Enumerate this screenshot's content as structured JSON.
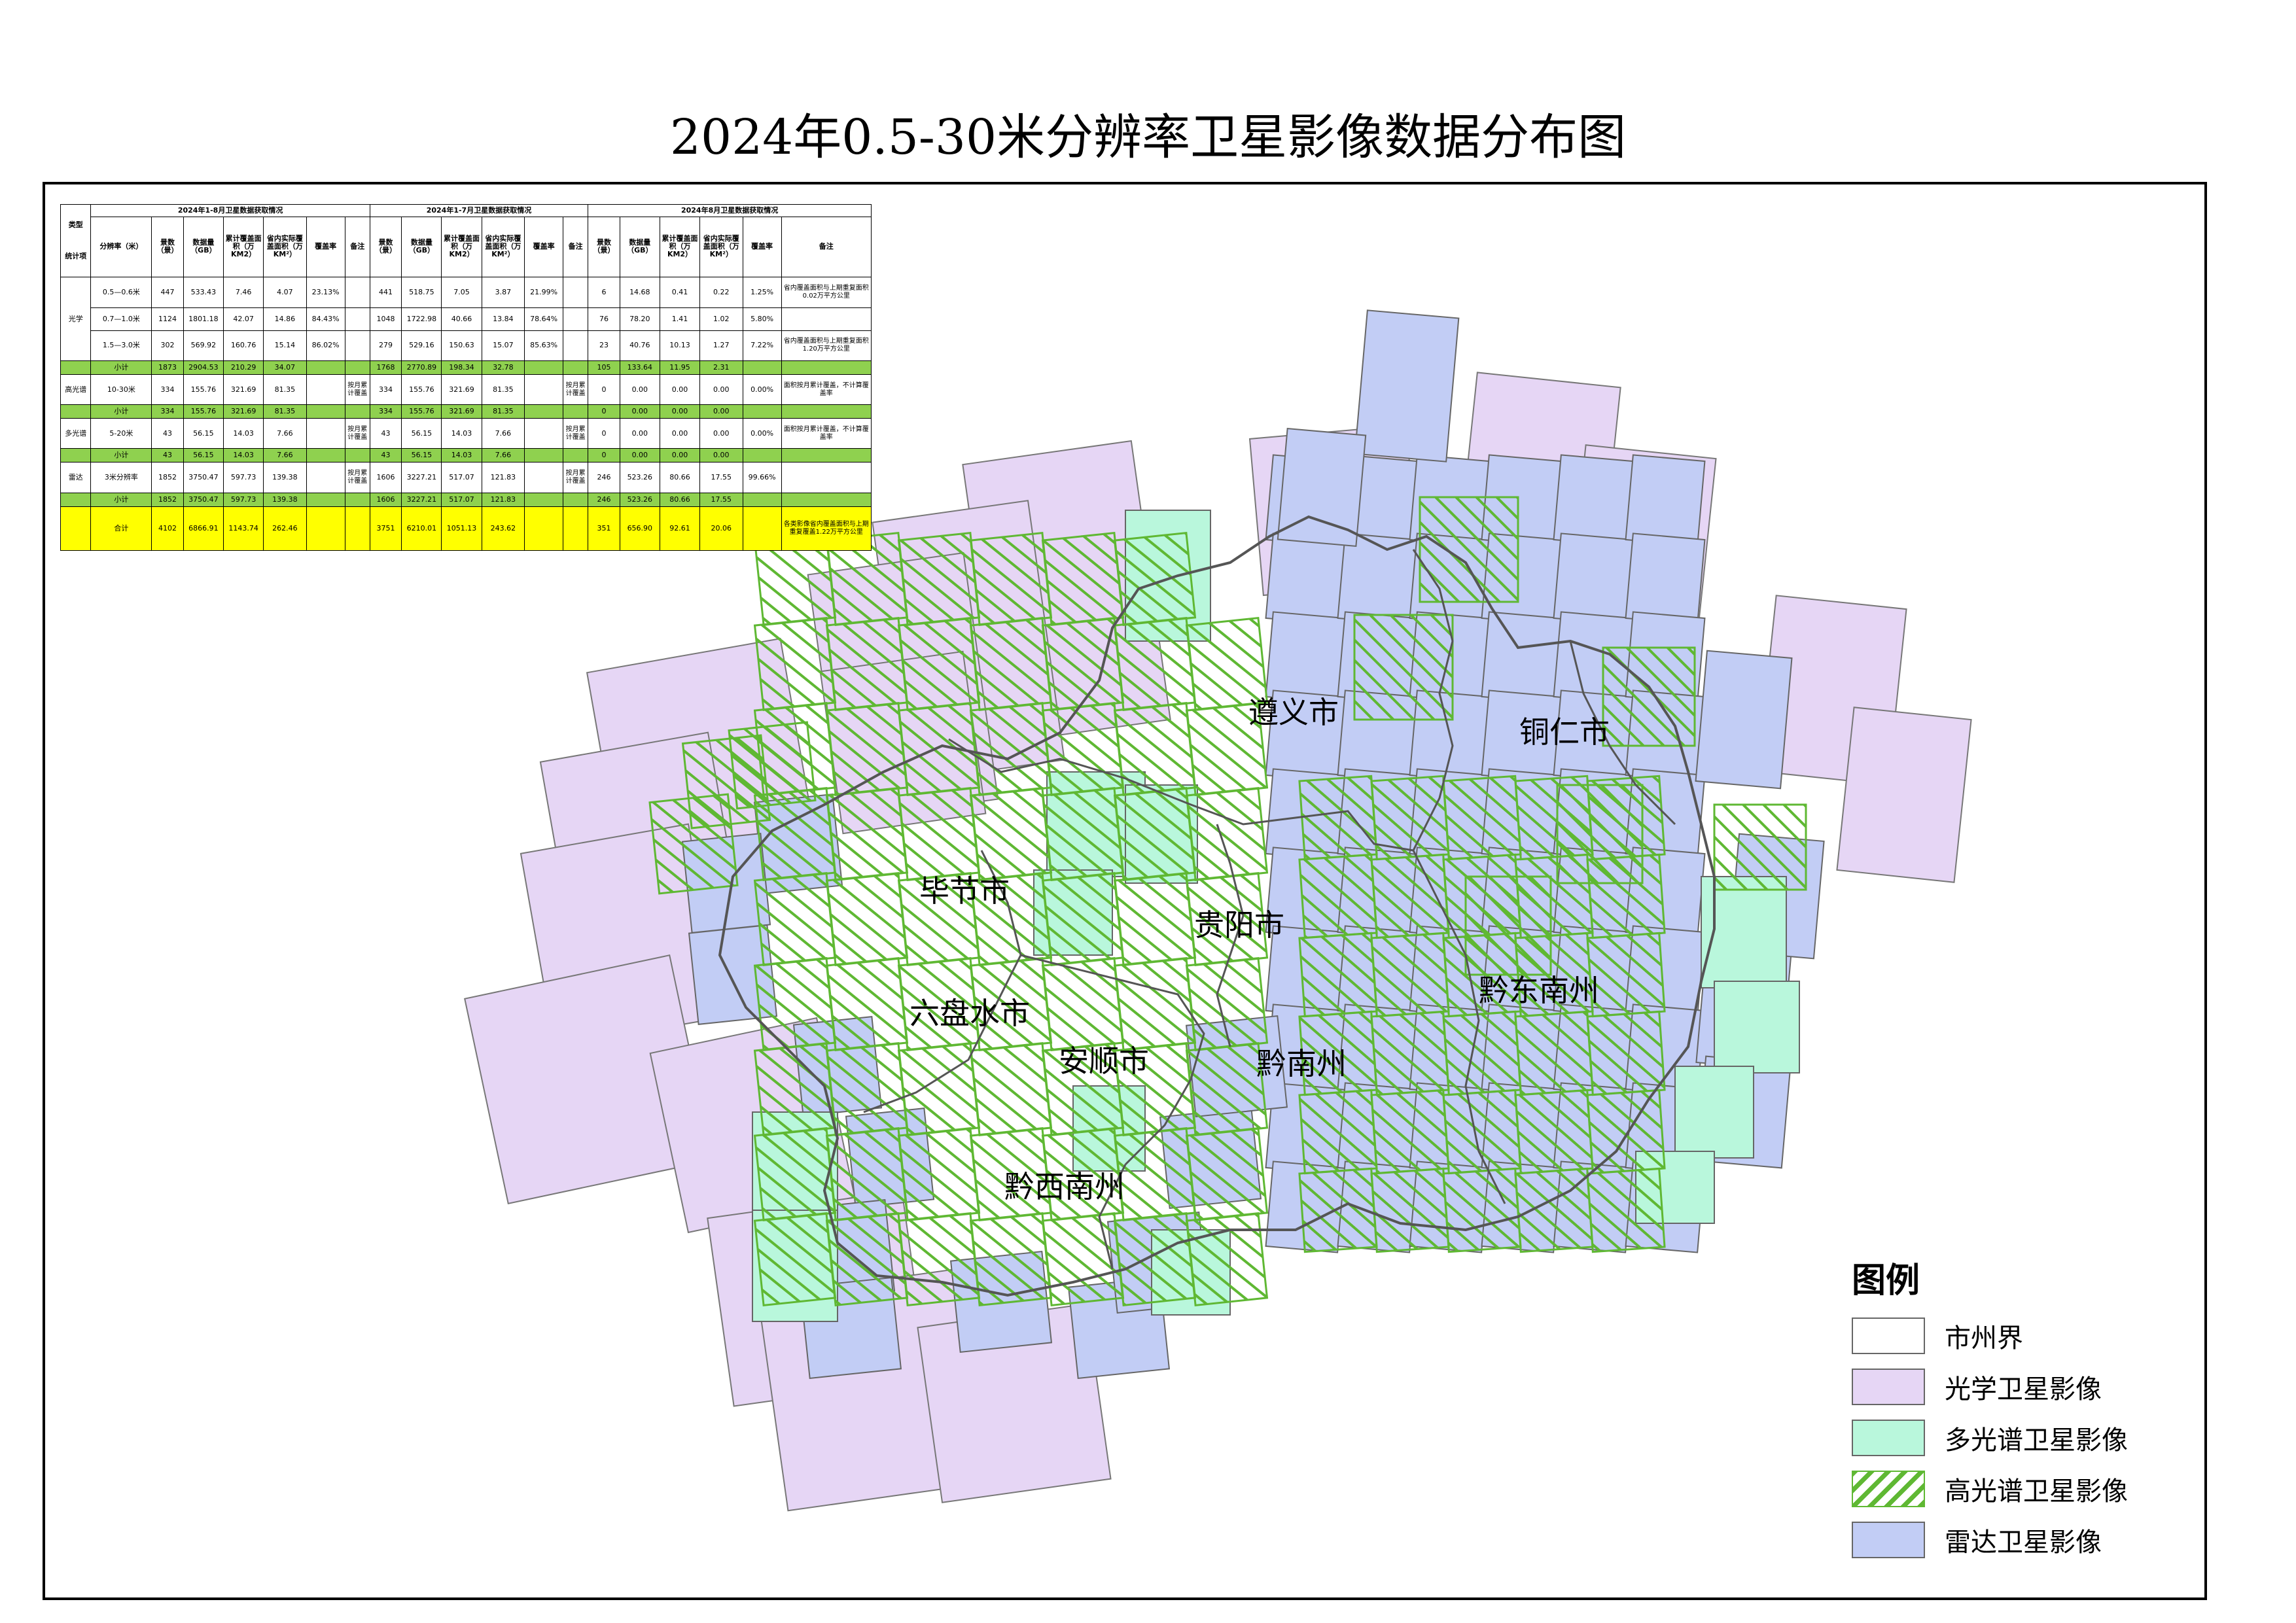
{
  "title": "2024年0.5-30米分辨率卫星影像数据分布图",
  "colors": {
    "optical": "#e6d6f5",
    "multispectral": "#b9f7dc",
    "hyperspectral": "#5fb833",
    "radar": "#c2cdf5",
    "boundary": "#555555"
  },
  "table": {
    "group_headers": [
      "2024年1-8月卫星数据获取情况",
      "2024年1-7月卫星数据获取情况",
      "2024年8月卫星数据获取情况"
    ],
    "corner": {
      "type": "类型",
      "stat": "统计项"
    },
    "col_headers": {
      "g1": [
        "分辨率（米）",
        "景数（景）",
        "数据量（GB）",
        "累计覆盖面积（万KM2）",
        "省内实际覆盖面积（万KM²）",
        "覆盖率",
        "备注"
      ],
      "g2": [
        "景数（景）",
        "数据量（GB）",
        "累计覆盖面积（万KM2）",
        "省内实际覆盖面积（万KM²）",
        "覆盖率",
        "备注"
      ],
      "g3": [
        "景数（景）",
        "数据量（GB）",
        "累计覆盖面积（万KM2）",
        "省内实际覆盖面积（万KM²）",
        "覆盖率",
        "备注"
      ]
    },
    "optical": {
      "type": "光学",
      "rows": [
        {
          "res": "0.5—0.6米",
          "g1": [
            "447",
            "533.43",
            "7.46",
            "4.07",
            "23.13%",
            ""
          ],
          "g2": [
            "441",
            "518.75",
            "7.05",
            "3.87",
            "21.99%",
            ""
          ],
          "g3": [
            "6",
            "14.68",
            "0.41",
            "0.22",
            "1.25%",
            "省内覆盖面积与上期重复面积0.02万平方公里"
          ]
        },
        {
          "res": "0.7—1.0米",
          "g1": [
            "1124",
            "1801.18",
            "42.07",
            "14.86",
            "84.43%",
            ""
          ],
          "g2": [
            "1048",
            "1722.98",
            "40.66",
            "13.84",
            "78.64%",
            ""
          ],
          "g3": [
            "76",
            "78.20",
            "1.41",
            "1.02",
            "5.80%",
            ""
          ]
        },
        {
          "res": "1.5—3.0米",
          "g1": [
            "302",
            "569.92",
            "160.76",
            "15.14",
            "86.02%",
            ""
          ],
          "g2": [
            "279",
            "529.16",
            "150.63",
            "15.07",
            "85.63%",
            ""
          ],
          "g3": [
            "23",
            "40.76",
            "10.13",
            "1.27",
            "7.22%",
            "省内覆盖面积与上期重复面积1.20万平方公里"
          ]
        }
      ],
      "subtotal": {
        "label": "小计",
        "g1": [
          "1873",
          "2904.53",
          "210.29",
          "34.07"
        ],
        "g2": [
          "1768",
          "2770.89",
          "198.34",
          "32.78"
        ],
        "g3": [
          "105",
          "133.64",
          "11.95",
          "2.31"
        ]
      }
    },
    "hyper": {
      "type": "高光谱",
      "row": {
        "res": "10-30米",
        "g1": [
          "334",
          "155.76",
          "321.69",
          "81.35",
          "",
          "按月累计覆盖"
        ],
        "g2": [
          "334",
          "155.76",
          "321.69",
          "81.35",
          "",
          "按月累计覆盖"
        ],
        "g3": [
          "0",
          "0.00",
          "0.00",
          "0.00",
          "0.00%",
          "面积按月累计覆盖，不计算覆盖率"
        ]
      },
      "subtotal": {
        "label": "小计",
        "g1": [
          "334",
          "155.76",
          "321.69",
          "81.35"
        ],
        "g2": [
          "334",
          "155.76",
          "321.69",
          "81.35"
        ],
        "g3": [
          "0",
          "0.00",
          "0.00",
          "0.00"
        ]
      }
    },
    "multi": {
      "type": "多光谱",
      "row": {
        "res": "5-20米",
        "g1": [
          "43",
          "56.15",
          "14.03",
          "7.66",
          "",
          "按月累计覆盖"
        ],
        "g2": [
          "43",
          "56.15",
          "14.03",
          "7.66",
          "",
          "按月累计覆盖"
        ],
        "g3": [
          "0",
          "0.00",
          "0.00",
          "0.00",
          "0.00%",
          "面积按月累计覆盖，不计算覆盖率"
        ]
      },
      "subtotal": {
        "label": "小计",
        "g1": [
          "43",
          "56.15",
          "14.03",
          "7.66"
        ],
        "g2": [
          "43",
          "56.15",
          "14.03",
          "7.66"
        ],
        "g3": [
          "0",
          "0.00",
          "0.00",
          "0.00"
        ]
      }
    },
    "radar": {
      "type": "雷达",
      "row": {
        "res": "3米分辨率",
        "g1": [
          "1852",
          "3750.47",
          "597.73",
          "139.38",
          "",
          "按月累计覆盖"
        ],
        "g2": [
          "1606",
          "3227.21",
          "517.07",
          "121.83",
          "",
          "按月累计覆盖"
        ],
        "g3": [
          "246",
          "523.26",
          "80.66",
          "17.55",
          "99.66%",
          ""
        ]
      },
      "subtotal": {
        "label": "小计",
        "g1": [
          "1852",
          "3750.47",
          "597.73",
          "139.38"
        ],
        "g2": [
          "1606",
          "3227.21",
          "517.07",
          "121.83"
        ],
        "g3": [
          "246",
          "523.26",
          "80.66",
          "17.55"
        ]
      }
    },
    "total": {
      "label": "合计",
      "g1": [
        "4102",
        "6866.91",
        "1143.74",
        "262.46"
      ],
      "g2": [
        "3751",
        "6210.01",
        "1051.13",
        "243.62"
      ],
      "g3": [
        "351",
        "656.90",
        "92.61",
        "20.06"
      ],
      "note": "各类影像省内覆盖面积与上期重复覆盖1.22万平方公里"
    }
  },
  "cities": [
    "遵义市",
    "铜仁市",
    "毕节市",
    "贵阳市",
    "六盘水市",
    "黔东南州",
    "安顺市",
    "黔南州",
    "黔西南州"
  ],
  "legend": {
    "title": "图例",
    "items": [
      "市州界",
      "光学卫星影像",
      "多光谱卫星影像",
      "高光谱卫星影像",
      "雷达卫星影像"
    ]
  }
}
